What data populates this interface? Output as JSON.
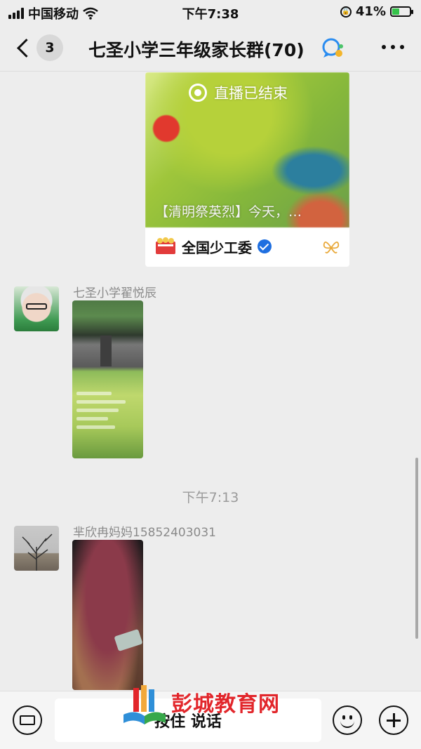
{
  "status_bar": {
    "carrier": "中国移动",
    "time": "下午7:38",
    "battery": "41%",
    "battery_level": 0.41
  },
  "nav": {
    "unread_count": "3",
    "title": "七圣小学三年级家长群(70)"
  },
  "messages": [
    {
      "type": "live_card",
      "status": "直播已结束",
      "caption": "【清明祭英烈】今天，…",
      "channel_name": "全国少工委"
    },
    {
      "type": "image",
      "sender": "七圣小学翟悦辰"
    },
    {
      "type": "time_divider",
      "time": "下午7:13"
    },
    {
      "type": "image",
      "sender": "芈欣冉妈妈15852403031"
    }
  ],
  "input_bar": {
    "hold_to_talk": "按住 说话"
  },
  "watermark": {
    "text": "彭城教育网"
  },
  "colors": {
    "background": "#ededed",
    "verified": "#1f6fe0",
    "watermark": "#e2262b"
  }
}
